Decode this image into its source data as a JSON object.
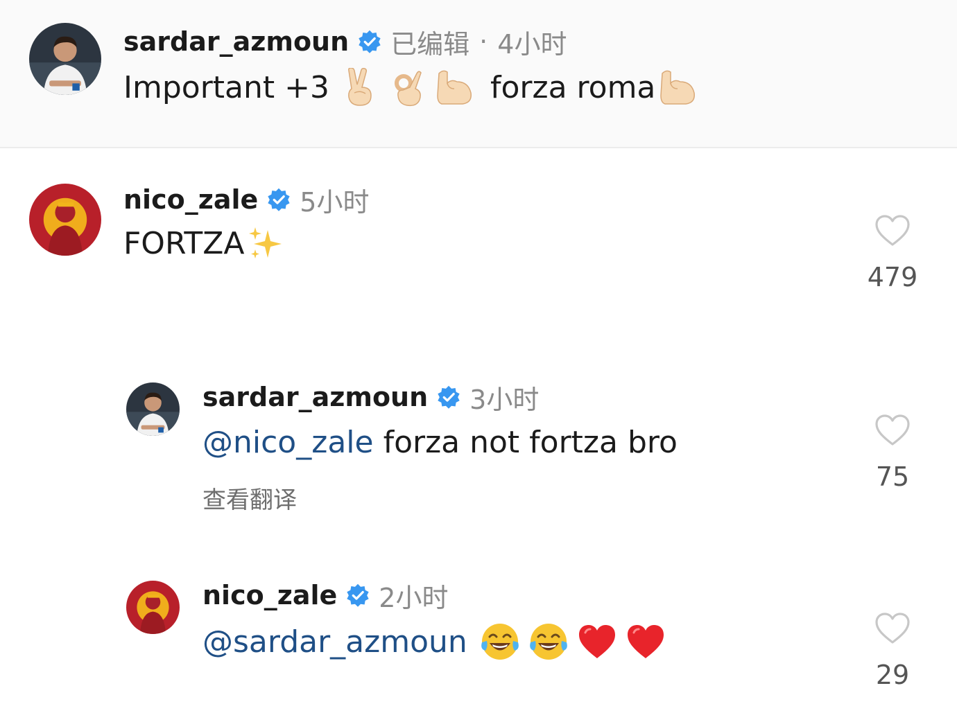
{
  "caption": {
    "username": "sardar_azmoun",
    "edited": "已编辑",
    "separator": "·",
    "time": "4小时",
    "text_main": "Important +3",
    "text_tail": "forza roma",
    "emojis": [
      "victory-hand-emoji",
      "ok-hand-emoji",
      "flexed-biceps-emoji",
      "flexed-biceps-emoji"
    ]
  },
  "comments": [
    {
      "username": "nico_zale",
      "time": "5小时",
      "text": "FORTZA",
      "emoji": "sparkles-emoji",
      "likes": "479"
    },
    {
      "username": "sardar_azmoun",
      "time": "3小时",
      "mention": "@nico_zale",
      "text": "forza not fortza bro",
      "translate": "查看翻译",
      "likes": "75"
    },
    {
      "username": "nico_zale",
      "time": "2小时",
      "mention": "@sardar_azmoun",
      "emojis": [
        "tears-of-joy-emoji",
        "tears-of-joy-emoji",
        "red-heart-emoji",
        "red-heart-emoji"
      ],
      "likes": "29"
    }
  ],
  "colors": {
    "verified": "#3897f0",
    "mention": "#1f4f86",
    "meta": "#8a8a8a",
    "heart_outline": "#c7c7c7",
    "roma_red": "#b8202a",
    "roma_gold": "#f2b51b"
  }
}
